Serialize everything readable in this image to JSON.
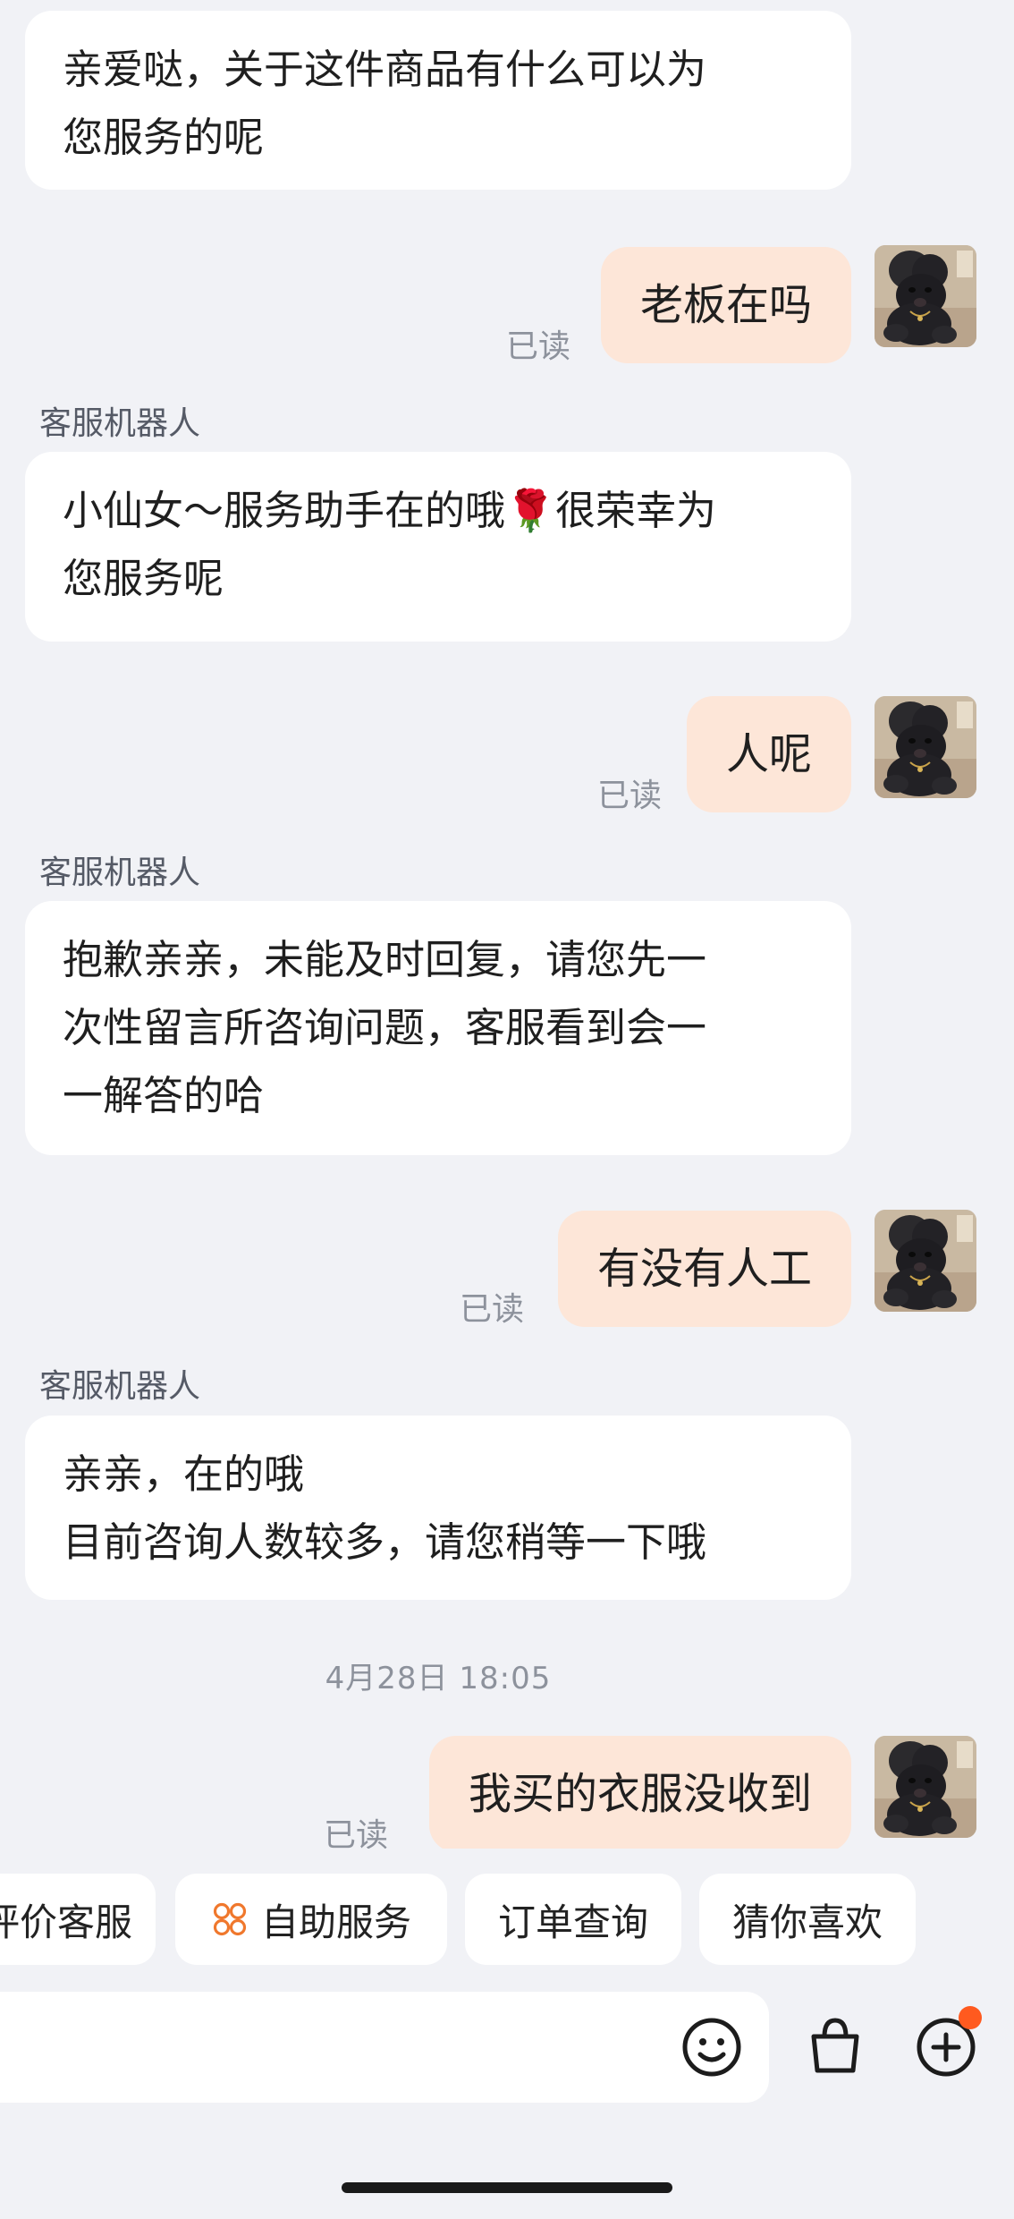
{
  "messages": [
    {
      "side": "bot",
      "text": "亲爱哒，关于这件商品有什么可以为\n您服务的呢"
    },
    {
      "side": "me",
      "text": "老板在吗",
      "status": "已读"
    },
    {
      "side": "bot",
      "sender": "客服机器人",
      "text": "小仙女～服务助手在的哦🌹很荣幸为\n您服务呢"
    },
    {
      "side": "me",
      "text": "人呢",
      "status": "已读"
    },
    {
      "side": "bot",
      "sender": "客服机器人",
      "text": "抱歉亲亲，未能及时回复，请您先一\n次性留言所咨询问题，客服看到会一\n一解答的哈"
    },
    {
      "side": "me",
      "text": "有没有人工",
      "status": "已读"
    },
    {
      "side": "bot",
      "sender": "客服机器人",
      "text": "亲亲，在的哦\n目前咨询人数较多，请您稍等一下哦"
    },
    {
      "side": "me",
      "text": "我买的衣服没收到",
      "status": "已读"
    }
  ],
  "timestamp": "4月28日 18:05",
  "quick_replies": [
    {
      "label": "评价客服",
      "icon": ""
    },
    {
      "label": "自助服务",
      "icon": "service-grid-icon"
    },
    {
      "label": "订单查询",
      "icon": ""
    },
    {
      "label": "猜你喜欢",
      "icon": ""
    }
  ],
  "input_bar": {
    "placeholder": "",
    "icons": [
      "emoji-icon",
      "shopping-bag-icon",
      "plus-icon"
    ],
    "has_notification": true
  },
  "colors": {
    "background": "#f1f2f6",
    "bot_bubble": "#ffffff",
    "user_bubble": "#fde6d8",
    "accent": "#ff5a1f",
    "muted_text": "#8d929c"
  }
}
